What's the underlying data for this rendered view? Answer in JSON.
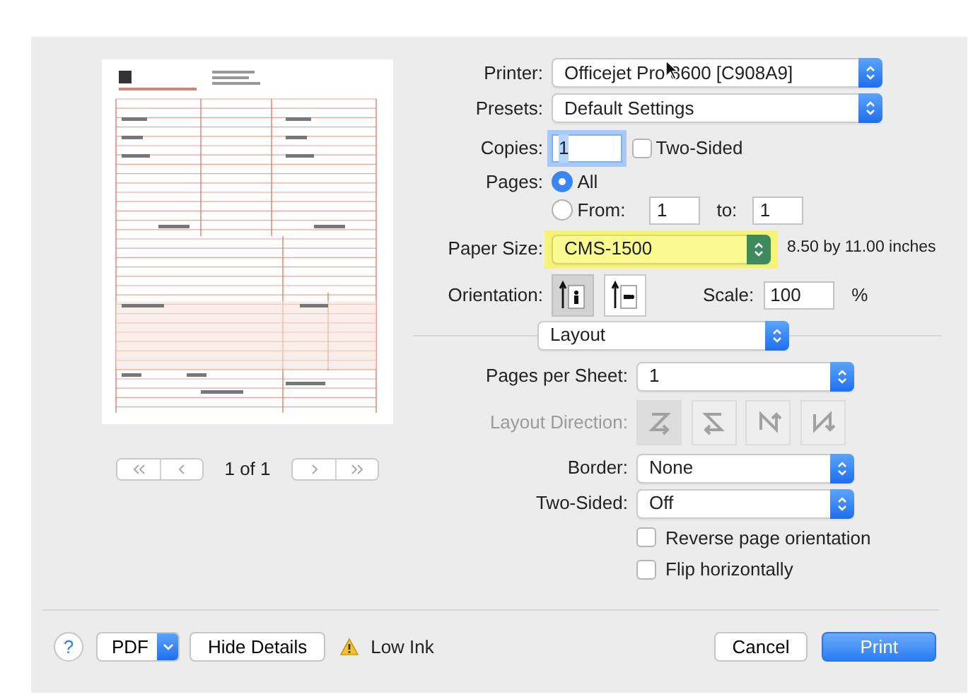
{
  "preview": {
    "page_label": "1 of 1"
  },
  "printer": {
    "label": "Printer:",
    "value": "Officejet Pro 8600 [C908A9]"
  },
  "presets": {
    "label": "Presets:",
    "value": "Default Settings"
  },
  "copies": {
    "label": "Copies:",
    "value": "1",
    "value_selected": true,
    "two_sided": {
      "label": "Two-Sided",
      "checked": false
    }
  },
  "pages": {
    "label": "Pages:",
    "options": [
      {
        "label": "All",
        "selected": true
      },
      {
        "label": "From:",
        "selected": false
      }
    ],
    "from": "1",
    "to_label": "to:",
    "to": "1"
  },
  "paper_size": {
    "label": "Paper Size:",
    "value": "CMS-1500",
    "highlighted": true,
    "dimensions": "8.50 by 11.00 inches"
  },
  "orientation": {
    "label": "Orientation:",
    "options": [
      {
        "kind": "portrait",
        "selected": true
      },
      {
        "kind": "landscape",
        "selected": false
      }
    ]
  },
  "scale": {
    "label": "Scale:",
    "value": "100",
    "unit": "%"
  },
  "panel": {
    "value": "Layout"
  },
  "layout": {
    "pages_per_sheet": {
      "label": "Pages per Sheet:",
      "value": "1"
    },
    "layout_direction": {
      "label": "Layout Direction:",
      "disabled": true,
      "options": [
        {
          "kind": "z",
          "selected": true
        },
        {
          "kind": "s",
          "selected": false
        },
        {
          "kind": "n_reverse",
          "selected": false
        },
        {
          "kind": "n",
          "selected": false
        }
      ]
    },
    "border": {
      "label": "Border:",
      "value": "None"
    },
    "two_sided": {
      "label": "Two-Sided:",
      "value": "Off"
    },
    "checkboxes": [
      {
        "label": "Reverse page orientation",
        "checked": false
      },
      {
        "label": "Flip horizontally",
        "checked": false
      }
    ]
  },
  "footer": {
    "help": "?",
    "pdf": "PDF",
    "hide_details": "Hide Details",
    "warning": "Low Ink",
    "cancel": "Cancel",
    "print": "Print"
  }
}
